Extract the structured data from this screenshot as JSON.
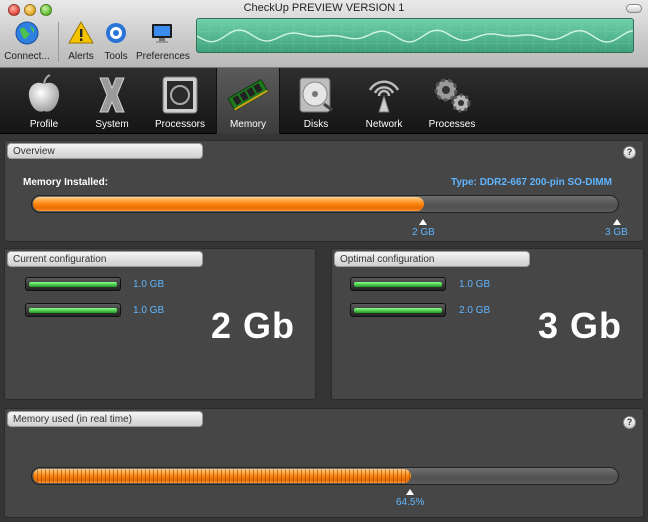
{
  "window": {
    "title": "CheckUp PREVIEW VERSION 1"
  },
  "toolbar": {
    "items": [
      {
        "label": "Connect..."
      },
      {
        "label": "Alerts"
      },
      {
        "label": "Tools"
      },
      {
        "label": "Preferences"
      }
    ]
  },
  "tabs": [
    {
      "label": "Profile",
      "icon": "apple-icon"
    },
    {
      "label": "System",
      "icon": "system-x-icon"
    },
    {
      "label": "Processors",
      "icon": "processor-icon"
    },
    {
      "label": "Memory",
      "icon": "memory-chip-icon",
      "active": true
    },
    {
      "label": "Disks",
      "icon": "disk-icon"
    },
    {
      "label": "Network",
      "icon": "antenna-icon"
    },
    {
      "label": "Processes",
      "icon": "gears-icon"
    }
  ],
  "overview": {
    "title": "Overview",
    "help": "?",
    "installed_label": "Memory Installed:",
    "type_label": "Type: DDR2-667 200-pin SO-DIMM",
    "installed_gb": 2,
    "max_gb": 3,
    "installed_fraction": 0.667,
    "marker_installed": "2 GB",
    "marker_max": "3 GB"
  },
  "current": {
    "title": "Current configuration",
    "slots": [
      "1.0 GB",
      "1.0 GB"
    ],
    "total": "2 Gb"
  },
  "optimal": {
    "title": "Optimal configuration",
    "slots": [
      "1.0 GB",
      "2.0 GB"
    ],
    "total": "3 Gb"
  },
  "realtime": {
    "title": "Memory used (in real time)",
    "help": "?",
    "used_percent": 64.5,
    "used_label": "64.5%"
  },
  "colors": {
    "accent_orange": "#ff8a14",
    "label_blue": "#5fb5ff",
    "dimm_green": "#3ad23a"
  }
}
